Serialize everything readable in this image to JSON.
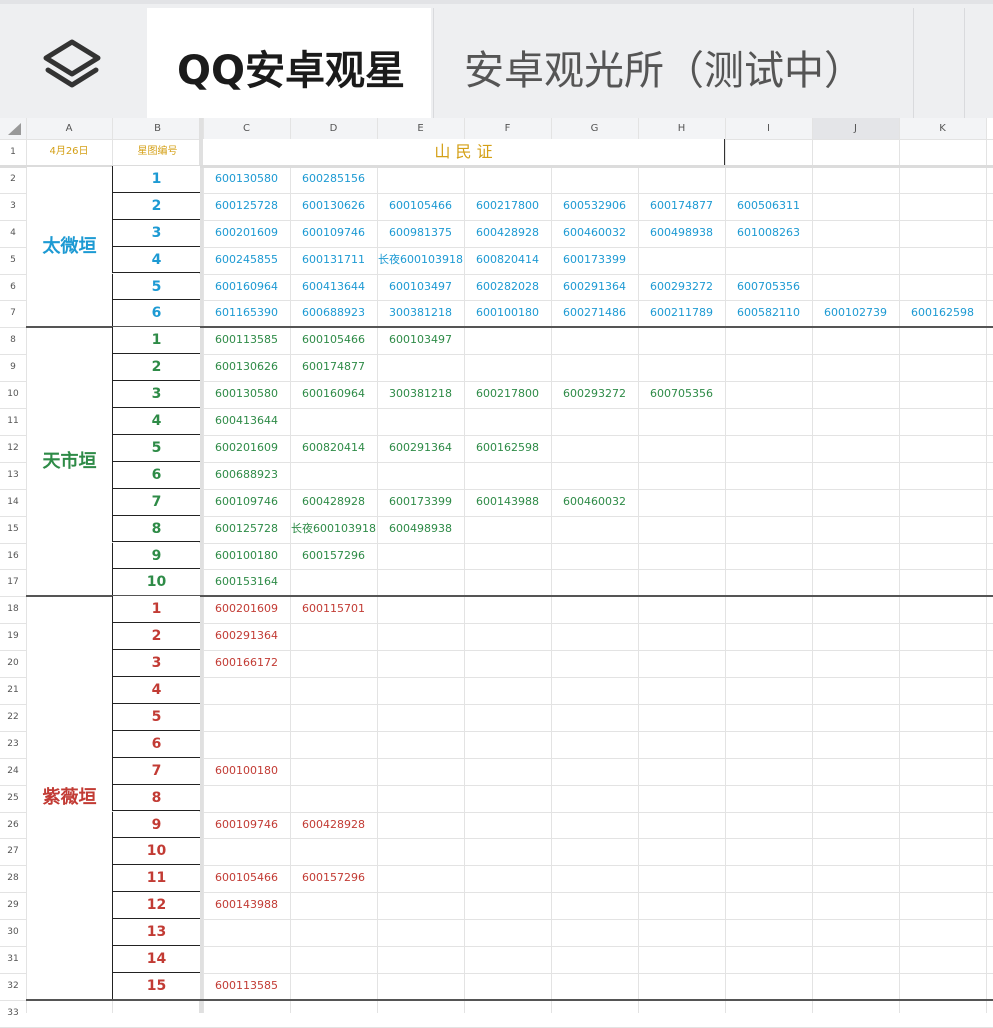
{
  "tabs": {
    "menu_icon": "layers-icon",
    "active_label": "QQ安卓观星",
    "second_label": "安卓观光所（测试中）"
  },
  "columns": [
    "A",
    "B",
    "C",
    "D",
    "E",
    "F",
    "G",
    "H",
    "I",
    "J",
    "K"
  ],
  "header_row": {
    "date": "4月26日",
    "map_no": "星图编号",
    "title": "山 民 证"
  },
  "row_numbers": [
    "1",
    "2",
    "3",
    "4",
    "5",
    "6",
    "7",
    "8",
    "9",
    "10",
    "11",
    "12",
    "13",
    "14",
    "15",
    "16",
    "17",
    "18",
    "19",
    "20",
    "21",
    "22",
    "23",
    "24",
    "25",
    "26",
    "27",
    "28",
    "29",
    "30",
    "31",
    "32",
    "33"
  ],
  "groups": [
    {
      "name": "太微垣",
      "color": "#1d9ad3",
      "rows": [
        {
          "n": "1",
          "codes": [
            "600130580",
            "600285156"
          ]
        },
        {
          "n": "2",
          "codes": [
            "600125728",
            "600130626",
            "600105466",
            "600217800",
            "600532906",
            "600174877",
            "600506311"
          ]
        },
        {
          "n": "3",
          "codes": [
            "600201609",
            "600109746",
            "600981375",
            "600428928",
            "600460032",
            "600498938",
            "601008263"
          ]
        },
        {
          "n": "4",
          "codes": [
            "600245855",
            "600131711",
            "长夜600103918",
            "600820414",
            "600173399"
          ]
        },
        {
          "n": "5",
          "codes": [
            "600160964",
            "600413644",
            "600103497",
            "600282028",
            "600291364",
            "600293272",
            "600705356"
          ]
        },
        {
          "n": "6",
          "codes": [
            "601165390",
            "600688923",
            "300381218",
            "600100180",
            "600271486",
            "600211789",
            "600582110",
            "600102739",
            "600162598"
          ]
        }
      ]
    },
    {
      "name": "天市垣",
      "color": "#2e8b47",
      "rows": [
        {
          "n": "1",
          "codes": [
            "600113585",
            "600105466",
            "600103497"
          ]
        },
        {
          "n": "2",
          "codes": [
            "600130626",
            "600174877"
          ]
        },
        {
          "n": "3",
          "codes": [
            "600130580",
            "600160964",
            "300381218",
            "600217800",
            "600293272",
            "600705356"
          ]
        },
        {
          "n": "4",
          "codes": [
            "600413644"
          ]
        },
        {
          "n": "5",
          "codes": [
            "600201609",
            "600820414",
            "600291364",
            "600162598"
          ]
        },
        {
          "n": "6",
          "codes": [
            "600688923"
          ]
        },
        {
          "n": "7",
          "codes": [
            "600109746",
            "600428928",
            "600173399",
            "600143988",
            "600460032"
          ]
        },
        {
          "n": "8",
          "codes": [
            "600125728",
            "长夜600103918",
            "600498938"
          ]
        },
        {
          "n": "9",
          "codes": [
            "600100180",
            "600157296"
          ]
        },
        {
          "n": "10",
          "codes": [
            "600153164"
          ]
        }
      ]
    },
    {
      "name": "紫薇垣",
      "color": "#c23b34",
      "rows": [
        {
          "n": "1",
          "codes": [
            "600201609",
            "600115701"
          ]
        },
        {
          "n": "2",
          "codes": [
            "600291364"
          ]
        },
        {
          "n": "3",
          "codes": [
            "600166172"
          ]
        },
        {
          "n": "4",
          "codes": []
        },
        {
          "n": "5",
          "codes": []
        },
        {
          "n": "6",
          "codes": []
        },
        {
          "n": "7",
          "codes": [
            "600100180"
          ]
        },
        {
          "n": "8",
          "codes": []
        },
        {
          "n": "9",
          "codes": [
            "600109746",
            "600428928"
          ]
        },
        {
          "n": "10",
          "codes": []
        },
        {
          "n": "11",
          "codes": [
            "600105466",
            "600157296"
          ]
        },
        {
          "n": "12",
          "codes": [
            "600143988"
          ]
        },
        {
          "n": "13",
          "codes": []
        },
        {
          "n": "14",
          "codes": []
        },
        {
          "n": "15",
          "codes": [
            "600113585"
          ]
        }
      ]
    }
  ]
}
